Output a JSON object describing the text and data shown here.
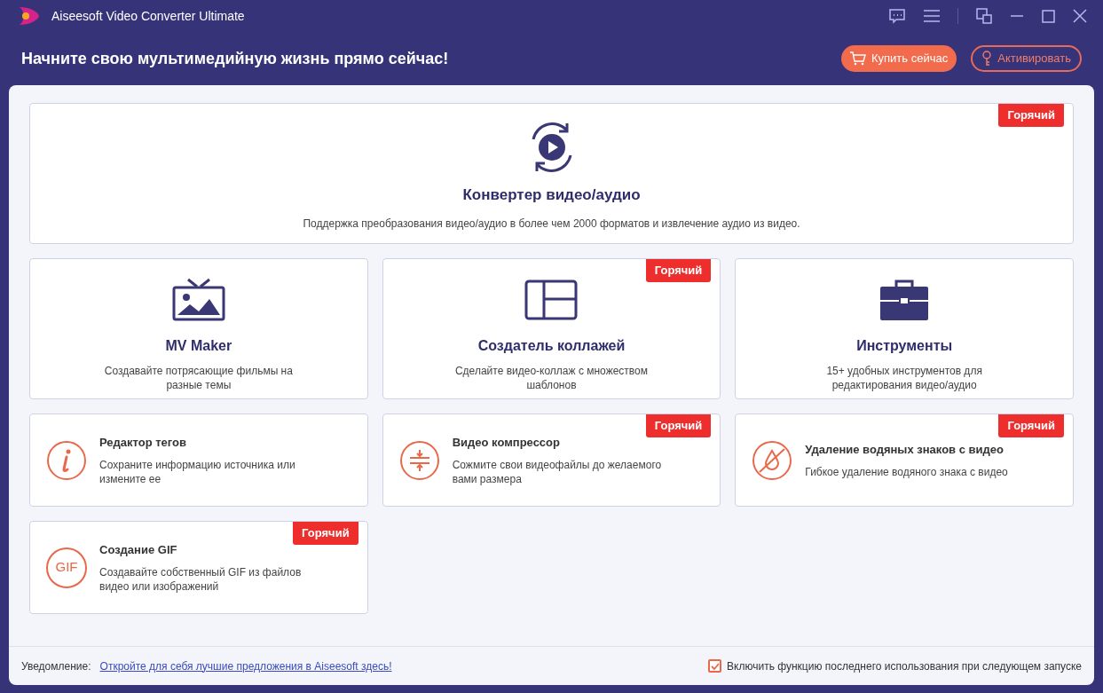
{
  "window": {
    "title": "Aiseesoft Video Converter Ultimate"
  },
  "header": {
    "slogan": "Начните свою мультимедийную жизнь прямо сейчас!",
    "buy_button": "Купить сейчас",
    "activate_button": "Активировать"
  },
  "hero": {
    "title": "Конвертер видео/аудио",
    "description": "Поддержка преобразования видео/аудио в более чем 2000 форматов и извлечение аудио из видео.",
    "badge": "Горячий"
  },
  "large_cards": [
    {
      "title": "MV Maker",
      "description": "Создавайте потрясающие фильмы на разные темы"
    },
    {
      "title": "Создатель коллажей",
      "description": "Сделайте видео-коллаж с множеством шаблонов",
      "badge": "Горячий"
    },
    {
      "title": "Инструменты",
      "description": "15+ удобных инструментов для редактирования видео/аудио"
    }
  ],
  "small_cards": [
    {
      "title": "Редактор тегов",
      "description": "Сохраните информацию источника или измените ее"
    },
    {
      "title": "Видео компрессор",
      "description": "Сожмите свои видеофайлы до желаемого вами размера",
      "badge": "Горячий"
    },
    {
      "title": "Удаление водяных знаков с видео",
      "description": "Гибкое удаление водяного знака с видео",
      "badge": "Горячий"
    },
    {
      "title": "Создание GIF",
      "description": "Создавайте собственный GIF из файлов видео или изображений",
      "badge": "Горячий",
      "icon_text": "GIF"
    }
  ],
  "footer": {
    "notice_label": "Уведомление:",
    "notice_link": "Откройте для себя лучшие предложения в Aiseesoft здесь!",
    "checkbox": {
      "label": "Включить функцию последнего использования при следующем запуске",
      "checked": true
    }
  }
}
